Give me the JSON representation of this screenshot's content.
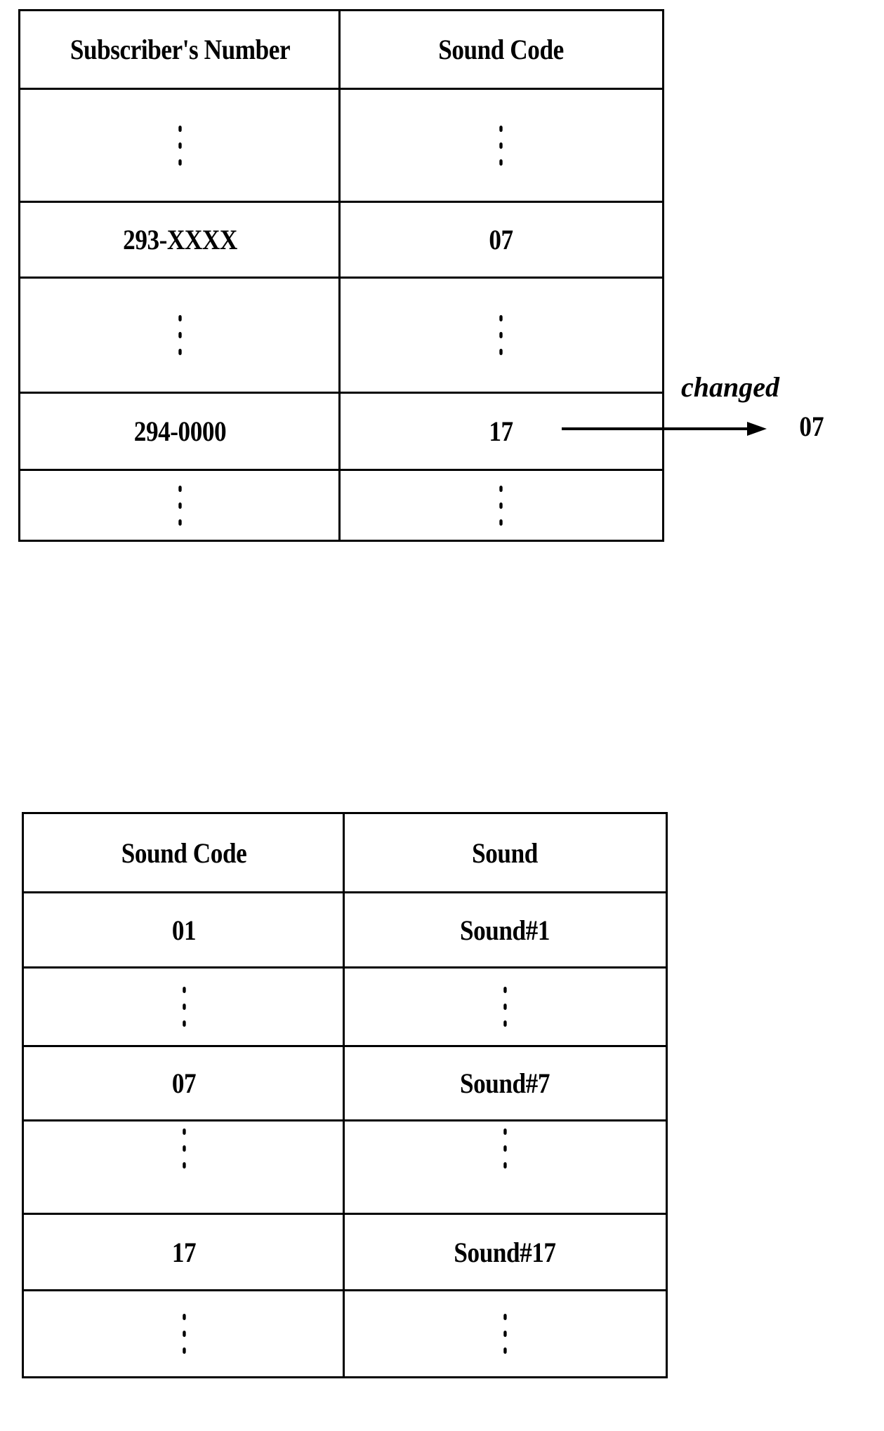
{
  "subscriber_table": {
    "headers": [
      "Subscriber's Number",
      "Sound Code"
    ],
    "rows": [
      {
        "number": "ellipsis",
        "code": "ellipsis"
      },
      {
        "number": "293-XXXX",
        "code": "07"
      },
      {
        "number": "ellipsis",
        "code": "ellipsis"
      },
      {
        "number": "294-0000",
        "code": "17"
      },
      {
        "number": "ellipsis",
        "code": "ellipsis"
      }
    ]
  },
  "change_annotation": {
    "label": "changed",
    "from": "17",
    "to": "07",
    "icon": "right-arrow-icon"
  },
  "sound_table": {
    "headers": [
      "Sound Code",
      "Sound"
    ],
    "rows": [
      {
        "code": "01",
        "sound": "Sound#1"
      },
      {
        "code": "ellipsis",
        "sound": "ellipsis"
      },
      {
        "code": "07",
        "sound": "Sound#7"
      },
      {
        "code": "ellipsis",
        "sound": "ellipsis"
      },
      {
        "code": "17",
        "sound": "Sound#17"
      },
      {
        "code": "ellipsis",
        "sound": "ellipsis"
      }
    ]
  }
}
